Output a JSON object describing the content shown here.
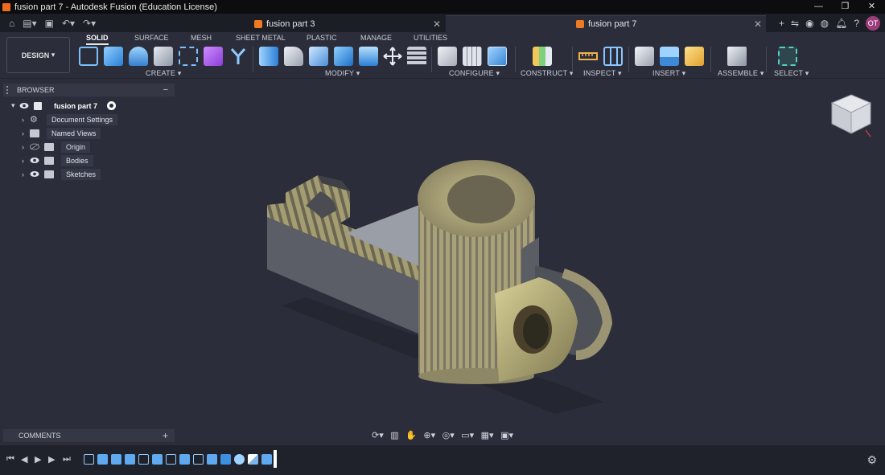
{
  "window": {
    "title": "fusion part 7 - Autodesk Fusion (Education License)"
  },
  "tabs": [
    {
      "label": "fusion part 3"
    },
    {
      "label": "fusion part 7"
    }
  ],
  "user": {
    "initials": "OT"
  },
  "workspace": {
    "label": "DESIGN"
  },
  "ribbon_tabs": [
    "SOLID",
    "SURFACE",
    "MESH",
    "SHEET METAL",
    "PLASTIC",
    "MANAGE",
    "UTILITIES"
  ],
  "tool_groups": [
    "CREATE",
    "MODIFY",
    "CONFIGURE",
    "CONSTRUCT",
    "INSPECT",
    "INSERT",
    "ASSEMBLE",
    "SELECT"
  ],
  "browser": {
    "title": "BROWSER",
    "root": "fusion part 7",
    "items": [
      "Document Settings",
      "Named Views",
      "Origin",
      "Bodies",
      "Sketches"
    ]
  },
  "comments": {
    "title": "COMMENTS"
  },
  "colors": {
    "accent": "#4c9de8",
    "orange": "#ef7a22",
    "avatar": "#9c3d7b",
    "background": "#2b2e3a"
  }
}
